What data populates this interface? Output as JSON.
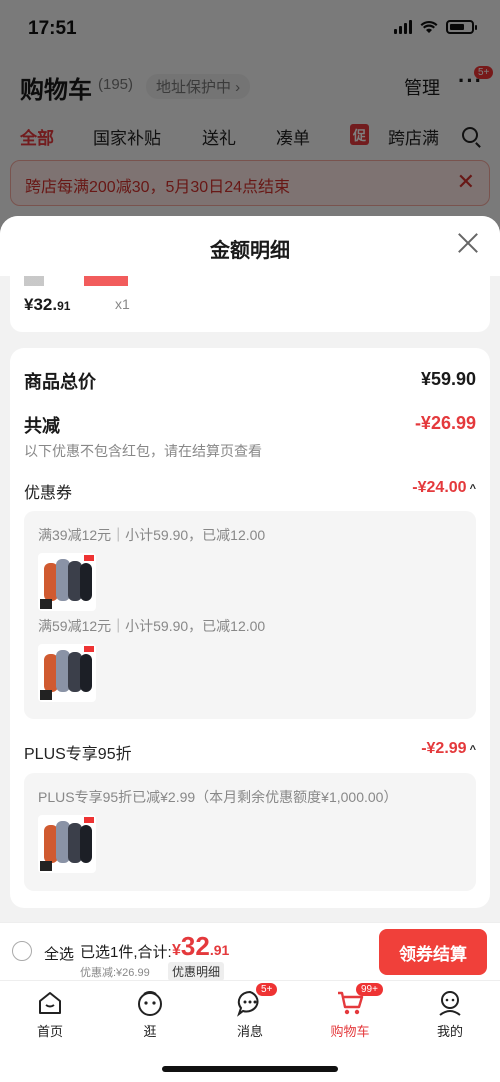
{
  "status": {
    "time": "17:51"
  },
  "header": {
    "title": "购物车",
    "count": "(195)",
    "address": "地址保护中",
    "manage": "管理",
    "more_badge": "5+"
  },
  "tabs": [
    "全部",
    "国家补贴",
    "送礼",
    "凑单",
    "跨店满"
  ],
  "promo_tag": "促",
  "notice": "跨店每满200减30，5月30日24点结束",
  "sheet": {
    "title": "金额明细",
    "item_price_main": "¥32.",
    "item_price_dec": "91",
    "item_qty": "x1",
    "total_label": "商品总价",
    "total_value": "¥59.90",
    "reduce_label": "共减",
    "reduce_value": "-¥26.99",
    "reduce_note": "以下优惠不包含红包，请在结算页查看",
    "coupon_label": "优惠券",
    "coupon_value": "-¥24.00",
    "coupons": [
      "满39减12元｜小计59.90，已减12.00",
      "满59减12元｜小计59.90，已减12.00"
    ],
    "plus_label": "PLUS专享95折",
    "plus_value": "-¥2.99",
    "plus_note": "PLUS专享95折已减¥2.99（本月剩余优惠额度¥1,000.00）"
  },
  "checkout": {
    "select_all": "全选",
    "selected": "已选1件,合计:",
    "currency": "¥",
    "total_int": "32",
    "total_dec": ".91",
    "discount": "优惠减:¥26.99",
    "detail": "优惠明细",
    "button": "领券结算"
  },
  "tabbar": [
    {
      "label": "首页"
    },
    {
      "label": "逛"
    },
    {
      "label": "消息",
      "badge": "5+"
    },
    {
      "label": "购物车",
      "badge": "99+"
    },
    {
      "label": "我的"
    }
  ],
  "colors": {
    "accent": "#e4393c",
    "button": "#f0403a"
  }
}
